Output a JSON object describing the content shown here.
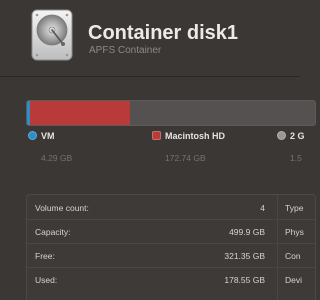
{
  "header": {
    "title": "Container disk1",
    "subtitle": "APFS Container",
    "icon": "hard-drive-icon"
  },
  "usage": {
    "segments": [
      {
        "name": "VM",
        "size": "4.29 GB",
        "color": "#2a8fc9",
        "fraction": 0.009
      },
      {
        "name": "Macintosh HD",
        "size": "172.74 GB",
        "color": "#b83b3a",
        "fraction": 0.346
      }
    ],
    "legend": [
      {
        "label": "VM",
        "size": "4.29 GB",
        "color": "#2a8fc9"
      },
      {
        "label": "Macintosh HD",
        "size": "172.74 GB",
        "color": "#b83b3a"
      },
      {
        "label": "2 G",
        "size": "1.5",
        "color": "#9a9694"
      }
    ]
  },
  "info": {
    "rows": [
      {
        "key": "Volume count:",
        "value": "4",
        "right_key": "Type"
      },
      {
        "key": "Capacity:",
        "value": "499.9 GB",
        "right_key": "Phys"
      },
      {
        "key": "Free:",
        "value": "321.35 GB",
        "right_key": "Con"
      },
      {
        "key": "Used:",
        "value": "178.55 GB",
        "right_key": "Devi"
      }
    ]
  }
}
